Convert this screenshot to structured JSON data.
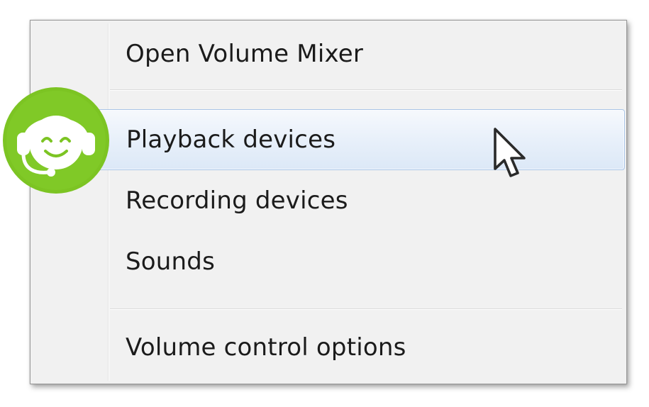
{
  "context_menu": {
    "items": [
      {
        "label": "Open Volume Mixer",
        "state": "normal"
      },
      {
        "label": "Playback devices",
        "state": "hovered"
      },
      {
        "label": "Recording devices",
        "state": "normal"
      },
      {
        "label": "Sounds",
        "state": "normal"
      },
      {
        "label": "Volume control options",
        "state": "normal"
      }
    ]
  },
  "icons": {
    "support_badge": "headset-support-icon",
    "pointer": "mouse-pointer-icon"
  },
  "colors": {
    "menu_background": "#f1f1f1",
    "hover_border": "#a9c4e6",
    "hover_fill": "#e8f0fa",
    "badge_green": "#7cc423",
    "text": "#1b1b1b"
  }
}
